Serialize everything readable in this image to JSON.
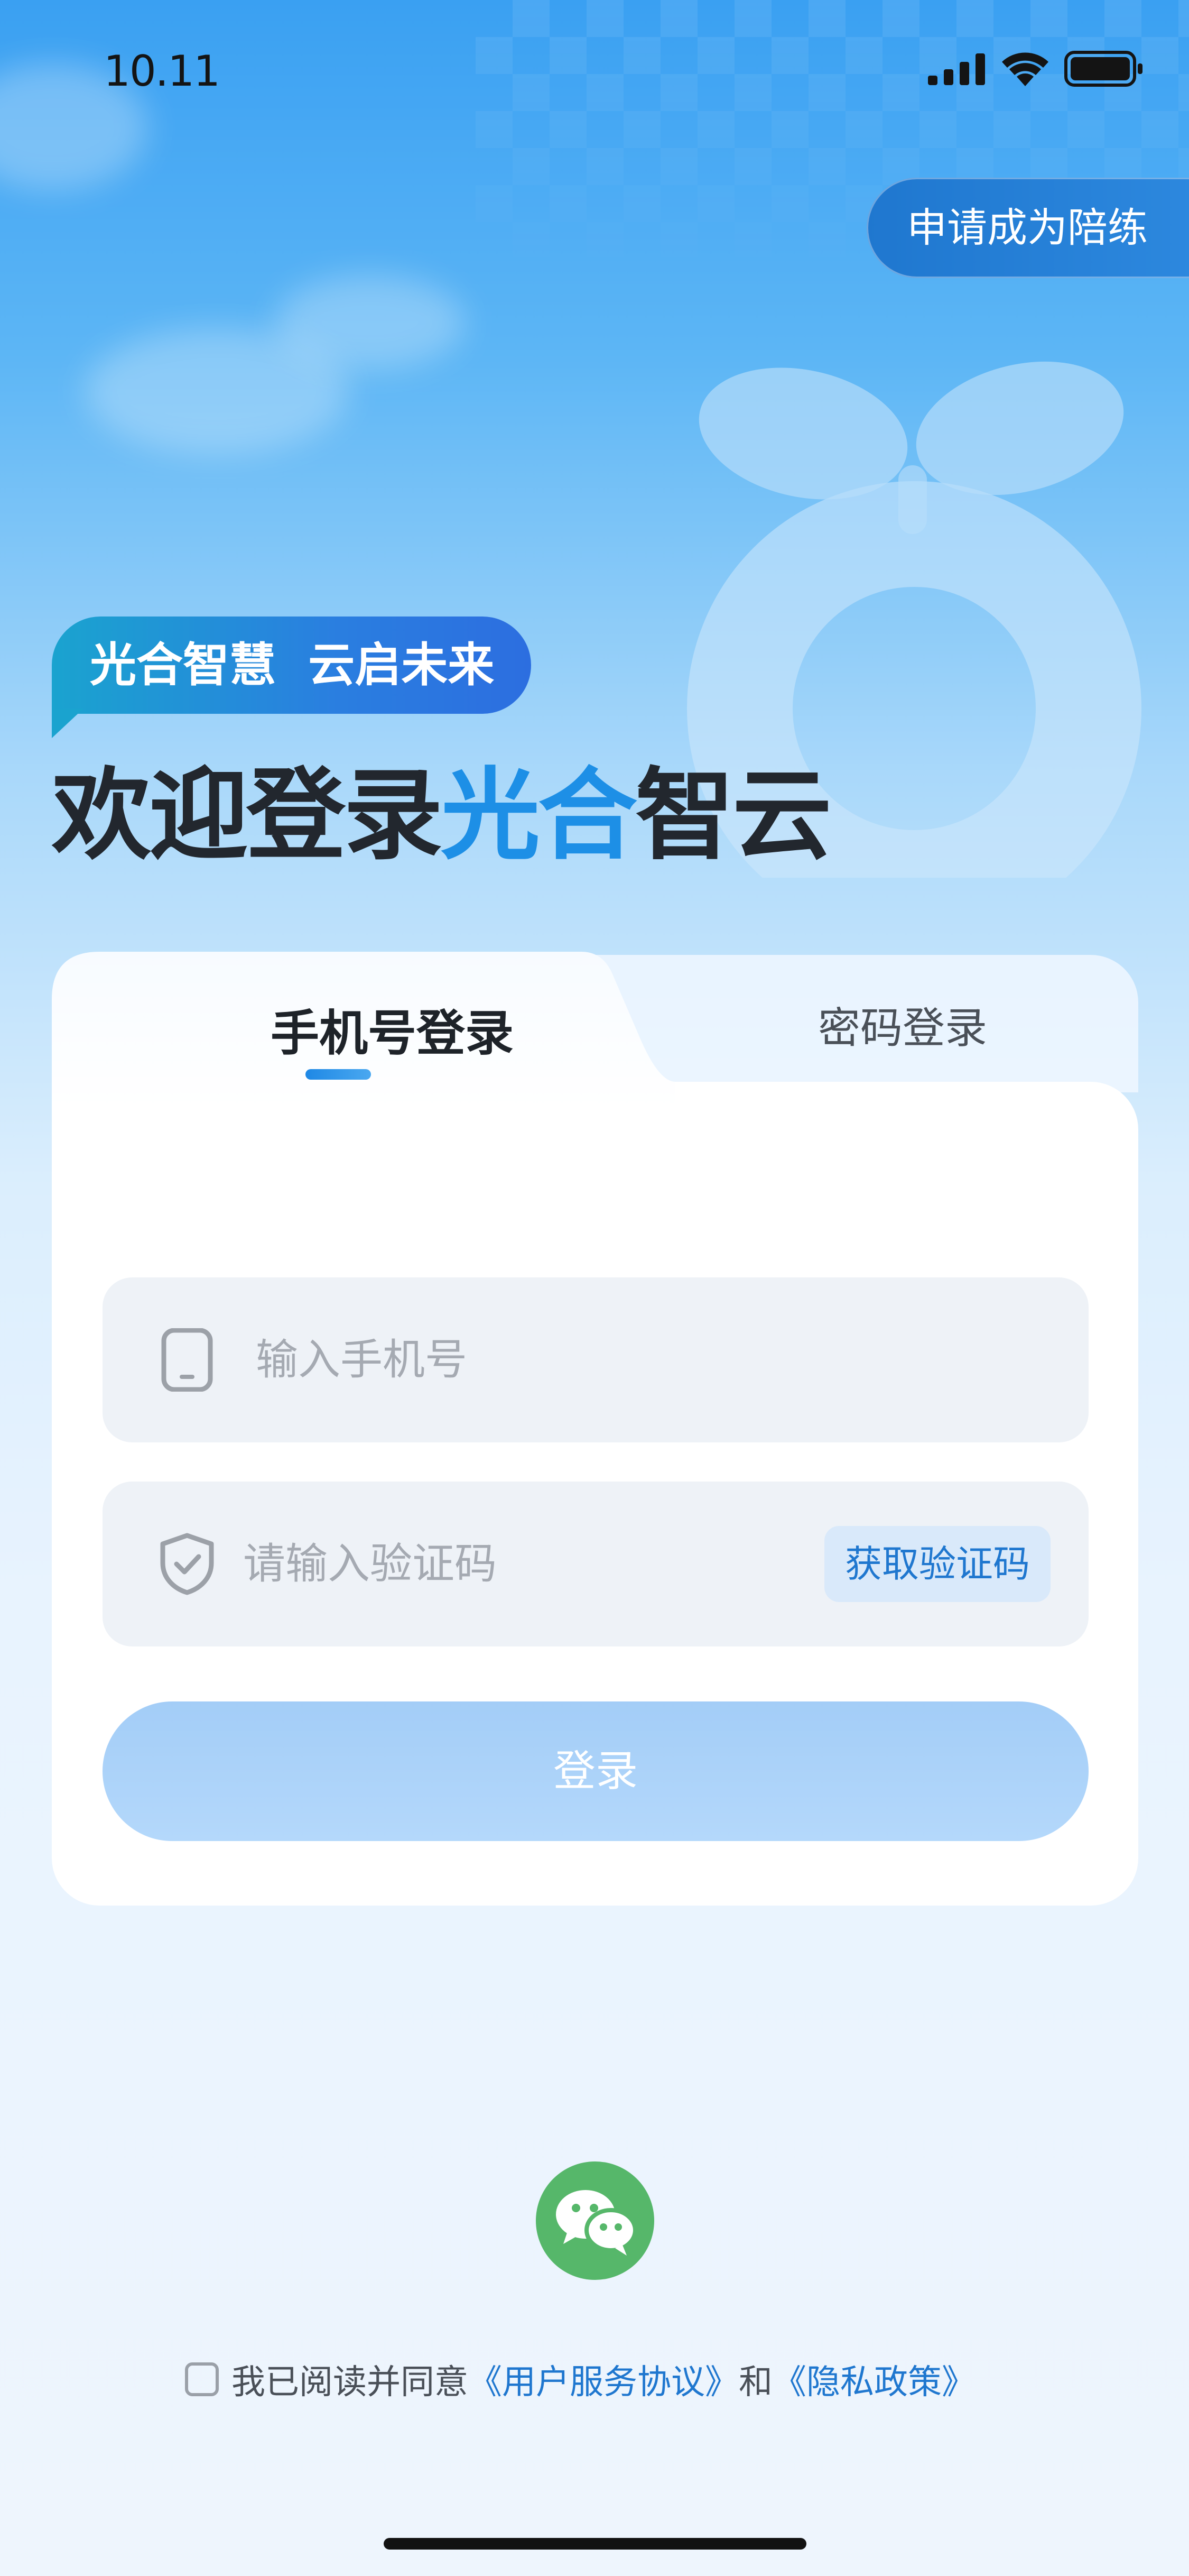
{
  "status_bar": {
    "time": "10.11",
    "icons": [
      "signal-icon",
      "wifi-icon",
      "battery-icon"
    ]
  },
  "header": {
    "apply_button_label": "申请成为陪练"
  },
  "hero": {
    "slogan": "光合智慧  云启未来",
    "welcome_prefix": "欢迎登录",
    "welcome_brand_highlight": "光合",
    "welcome_brand_rest": "智云",
    "mascot_icon": "sprout-mascot-icon"
  },
  "login_card": {
    "tabs": [
      {
        "label": "手机号登录",
        "active": true
      },
      {
        "label": "密码登录",
        "active": false
      }
    ],
    "phone_input": {
      "placeholder": "输入手机号",
      "icon": "phone-icon"
    },
    "code_input": {
      "placeholder": "请输入验证码",
      "icon": "shield-check-icon",
      "get_code_label": "获取验证码"
    },
    "login_button_label": "登录"
  },
  "third_party": {
    "wechat_icon": "wechat-icon"
  },
  "agreement": {
    "checked": false,
    "prefix": "我已阅读并同意",
    "user_agreement": "《用户服务协议》",
    "conjunction": "和",
    "privacy_policy": "《隐私政策》"
  },
  "colors": {
    "brand_blue": "#1d8fe6",
    "title_dark": "#22272e",
    "link_blue": "#1f77cf",
    "wechat_green": "#56b76a",
    "login_button": "#a3cdf7"
  }
}
